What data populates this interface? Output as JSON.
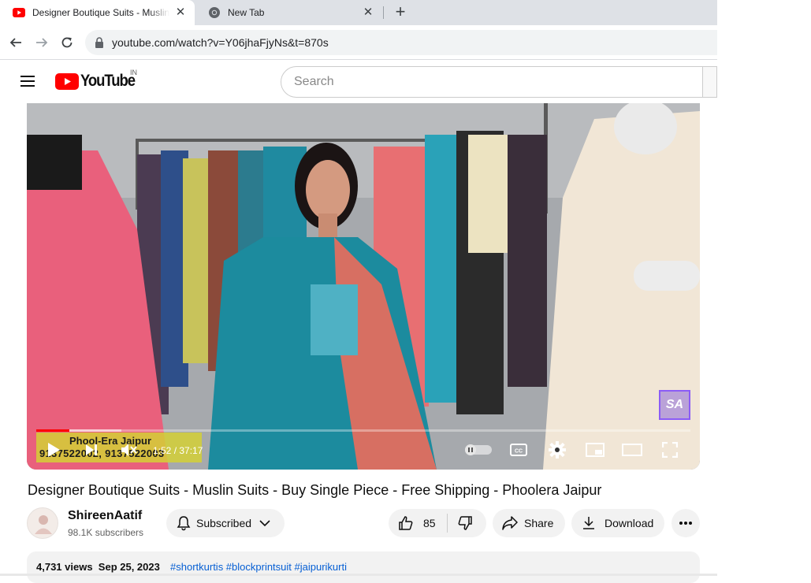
{
  "browser": {
    "tabs": [
      {
        "title": "Designer Boutique Suits - Muslin Suits - Buy Single Piece",
        "active": true,
        "icon": "youtube-favicon-icon"
      },
      {
        "title": "New Tab",
        "active": false,
        "icon": "chrome-icon"
      }
    ],
    "url": "youtube.com/watch?v=Y06jhaFjyNs&t=870s"
  },
  "youtube": {
    "logo_text": "YouTube",
    "country_code": "IN",
    "search_placeholder": "Search"
  },
  "player": {
    "overlay_line1": "Phool-Era Jaipur",
    "overlay_line2": "9137522002, 9137522003",
    "time_current": "1:52",
    "time_total": "37:17",
    "timecode": "1:52 / 37:17",
    "watermark": "SA",
    "progress_fraction": 0.05,
    "buffer_fraction": 0.13
  },
  "video": {
    "title": "Designer Boutique Suits - Muslin Suits - Buy Single Piece - Free Shipping - Phoolera Jaipur",
    "channel": "ShireenAatif",
    "subscribers": "98.1K subscribers",
    "subscribed_label": "Subscribed",
    "likes": "85",
    "share_label": "Share",
    "download_label": "Download",
    "views": "4,731 views",
    "date": "Sep 25, 2023",
    "hashtags": "#shortkurtis #blockprintsuit #jaipurikurti"
  },
  "colors": {
    "brand_red": "#ff0000",
    "link_blue": "#065fd4",
    "pill_bg": "#f2f2f2"
  }
}
